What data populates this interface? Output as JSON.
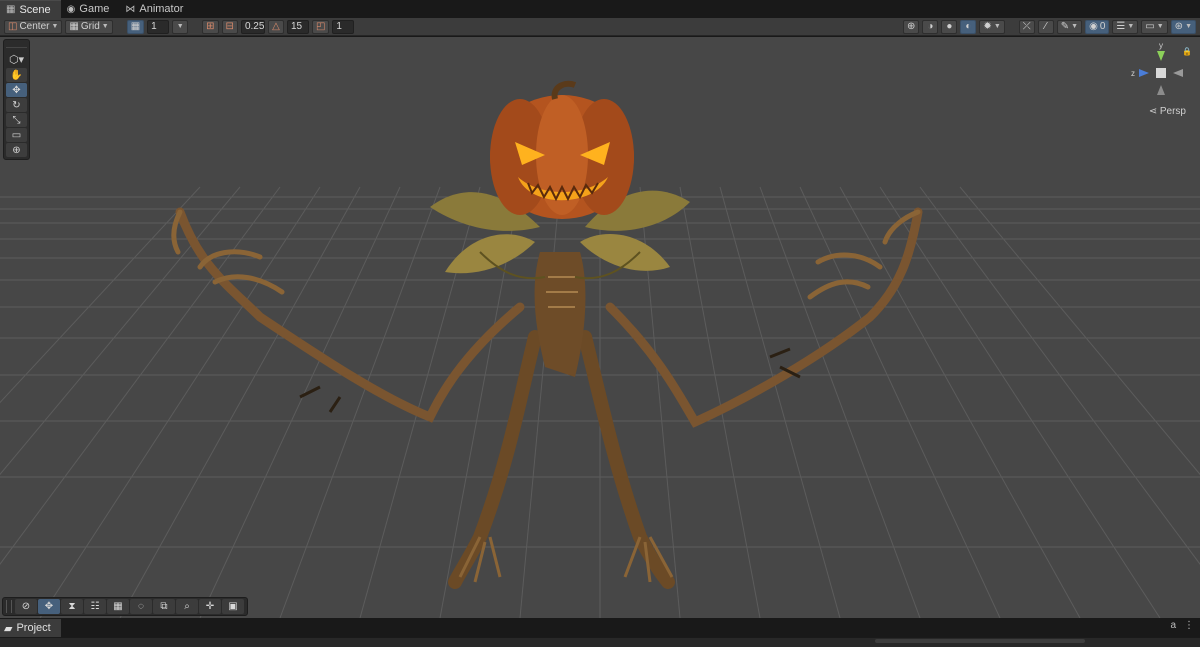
{
  "tabs": [
    {
      "label": "Scene",
      "icon": "grid-icon",
      "glyph": "▦",
      "active": true
    },
    {
      "label": "Game",
      "icon": "gamepad-icon",
      "glyph": "◉",
      "active": false
    },
    {
      "label": "Animator",
      "icon": "animator-icon",
      "glyph": "⋈",
      "active": false
    }
  ],
  "toolbar": {
    "pivot_label": "Center",
    "grid_label": "Grid",
    "grid_size_value": "1",
    "snap_increment_value": "0.25",
    "rotate_snap_value": "15",
    "scale_snap_value": "1",
    "visibility_count": "0"
  },
  "gizmo": {
    "y_label": "y",
    "z_label": "z",
    "projection_label": "Persp"
  },
  "bottom": {
    "project_tab_label": "Project"
  },
  "colors": {
    "accent": "#46607c",
    "viewport_bg": "#474747",
    "panel_bg": "#3c3c3c"
  }
}
